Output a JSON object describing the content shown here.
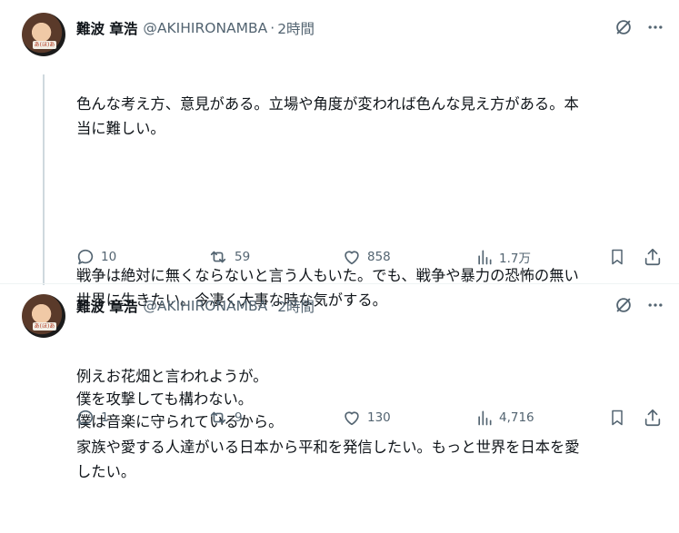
{
  "tweets": [
    {
      "author": {
        "name": "難波 章浩",
        "handle": "@AKIHIRONAMBA",
        "avatar_badge": "あ(ほ)あ"
      },
      "separator": "·",
      "time": "2時間",
      "paragraphs": [
        "色んな考え方、意見がある。立場や角度が変われば色んな見え方がある。本\n当に難しい。",
        "戦争は絶対に無くならないと言う人もいた。でも、戦争や暴力の恐怖の無い\n世界に生きたい。今凄く大事な時な気がする。",
        "家族や愛する人達がいる日本から平和を発信したい。もっと世界を日本を愛\nしたい。"
      ],
      "stats": {
        "replies": "10",
        "reposts": "59",
        "likes": "858",
        "views": "1.7万"
      }
    },
    {
      "author": {
        "name": "難波 章浩",
        "handle": "@AKIHIRONAMBA",
        "avatar_badge": "あ(ほ)あ"
      },
      "separator": "·",
      "time": "2時間",
      "paragraphs": [
        "例えお花畑と言われようが。\n僕を攻撃しても構わない。\n僕は音楽に守られているから。"
      ],
      "stats": {
        "replies": "1",
        "reposts": "9",
        "likes": "130",
        "views": "4,716"
      }
    }
  ],
  "colors": {
    "text": "#0f1419",
    "secondary": "#536471",
    "divider": "#eff3f4",
    "thread_line": "#cfd9de"
  },
  "icons": [
    "grok-icon",
    "more-icon",
    "reply-icon",
    "repost-icon",
    "like-icon",
    "views-icon",
    "bookmark-icon",
    "share-icon"
  ]
}
